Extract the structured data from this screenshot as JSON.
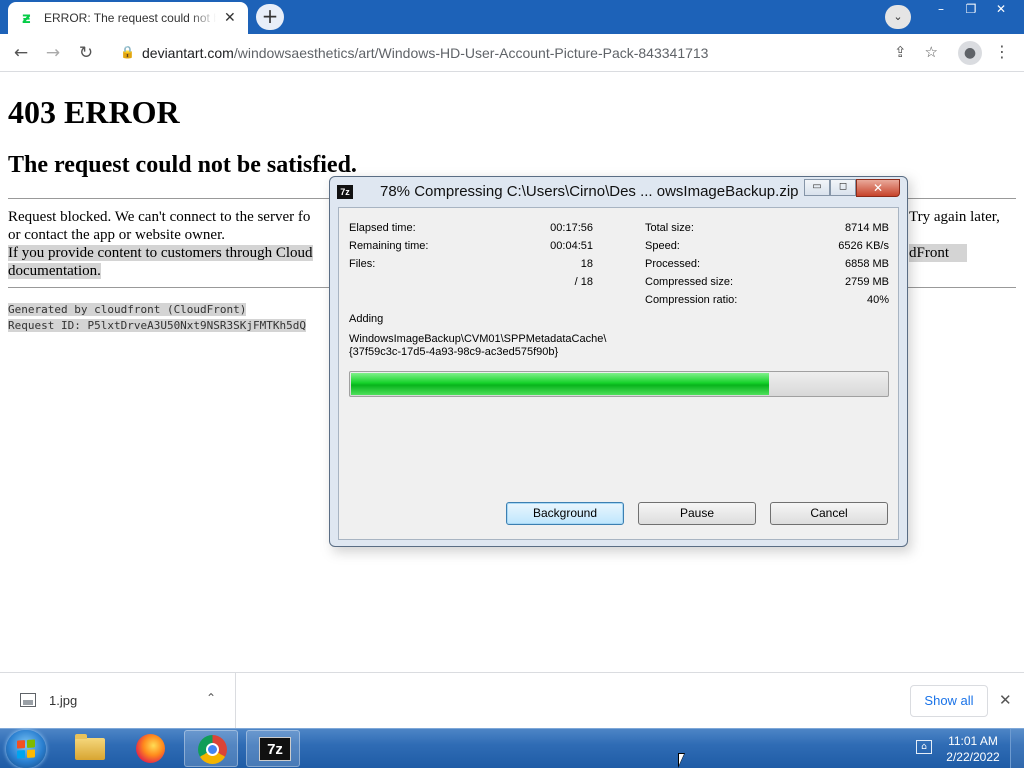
{
  "browser": {
    "tab_title": "ERROR: The request could not be satisfied",
    "tab_close": "✕",
    "new_tab": "+",
    "url_host": "deviantart.com",
    "url_path": "/windowsaesthetics/art/Windows-HD-User-Account-Picture-Pack-843341713",
    "window_buttons": [
      "–",
      "❐",
      "✕"
    ]
  },
  "page": {
    "heading": "403 ERROR",
    "subheading": "The request could not be satisfied.",
    "para1_line1_left": "Request blocked. We can't connect to the server fo",
    "para1_line1_right": "Try again later,",
    "para1_line2": "or contact the app or website owner.",
    "para2_line1_left": "If you provide content to customers through Cloud",
    "para2_line1_right": "dFront",
    "para2_line2": "documentation.",
    "generated_by": "Generated by cloudfront (CloudFront)",
    "request_id": "Request ID: P5lxtDrveA3U50Nxt9NSR3SKjFMTKh5dQ"
  },
  "dialog": {
    "title": "78% Compressing C:\\Users\\Cirno\\Des ... owsImageBackup.zip",
    "icon_label": "7z",
    "left_stats": [
      {
        "label": "Elapsed time:",
        "value": "00:17:56"
      },
      {
        "label": "Remaining time:",
        "value": "00:04:51"
      },
      {
        "label": "Files:",
        "value": "18"
      },
      {
        "label": "",
        "value": "/ 18"
      }
    ],
    "right_stats": [
      {
        "label": "Total size:",
        "value": "8714 MB"
      },
      {
        "label": "Speed:",
        "value": "6526 KB/s"
      },
      {
        "label": "Processed:",
        "value": "6858 MB"
      },
      {
        "label": "Compressed size:",
        "value": "2759 MB"
      },
      {
        "label": "Compression ratio:",
        "value": "40%"
      }
    ],
    "action": "Adding",
    "path_line1": "WindowsImageBackup\\CVM01\\SPPMetadataCache\\",
    "path_line2": "{37f59c3c-17d5-4a93-98c9-ac3ed575f90b}",
    "progress_percent": 78,
    "buttons": {
      "background": "Background",
      "pause": "Pause",
      "cancel": "Cancel"
    }
  },
  "downloads": {
    "file_name": "1.jpg",
    "show_all": "Show all"
  },
  "taskbar": {
    "time": "11:01 AM",
    "date": "2/22/2022",
    "sevenzip_label": "7z"
  },
  "colors": {
    "tabstrip": "#1d62b8",
    "progress_green": "#16d22a",
    "taskbar": "#2f6cb5",
    "link_blue": "#1a73e8"
  }
}
